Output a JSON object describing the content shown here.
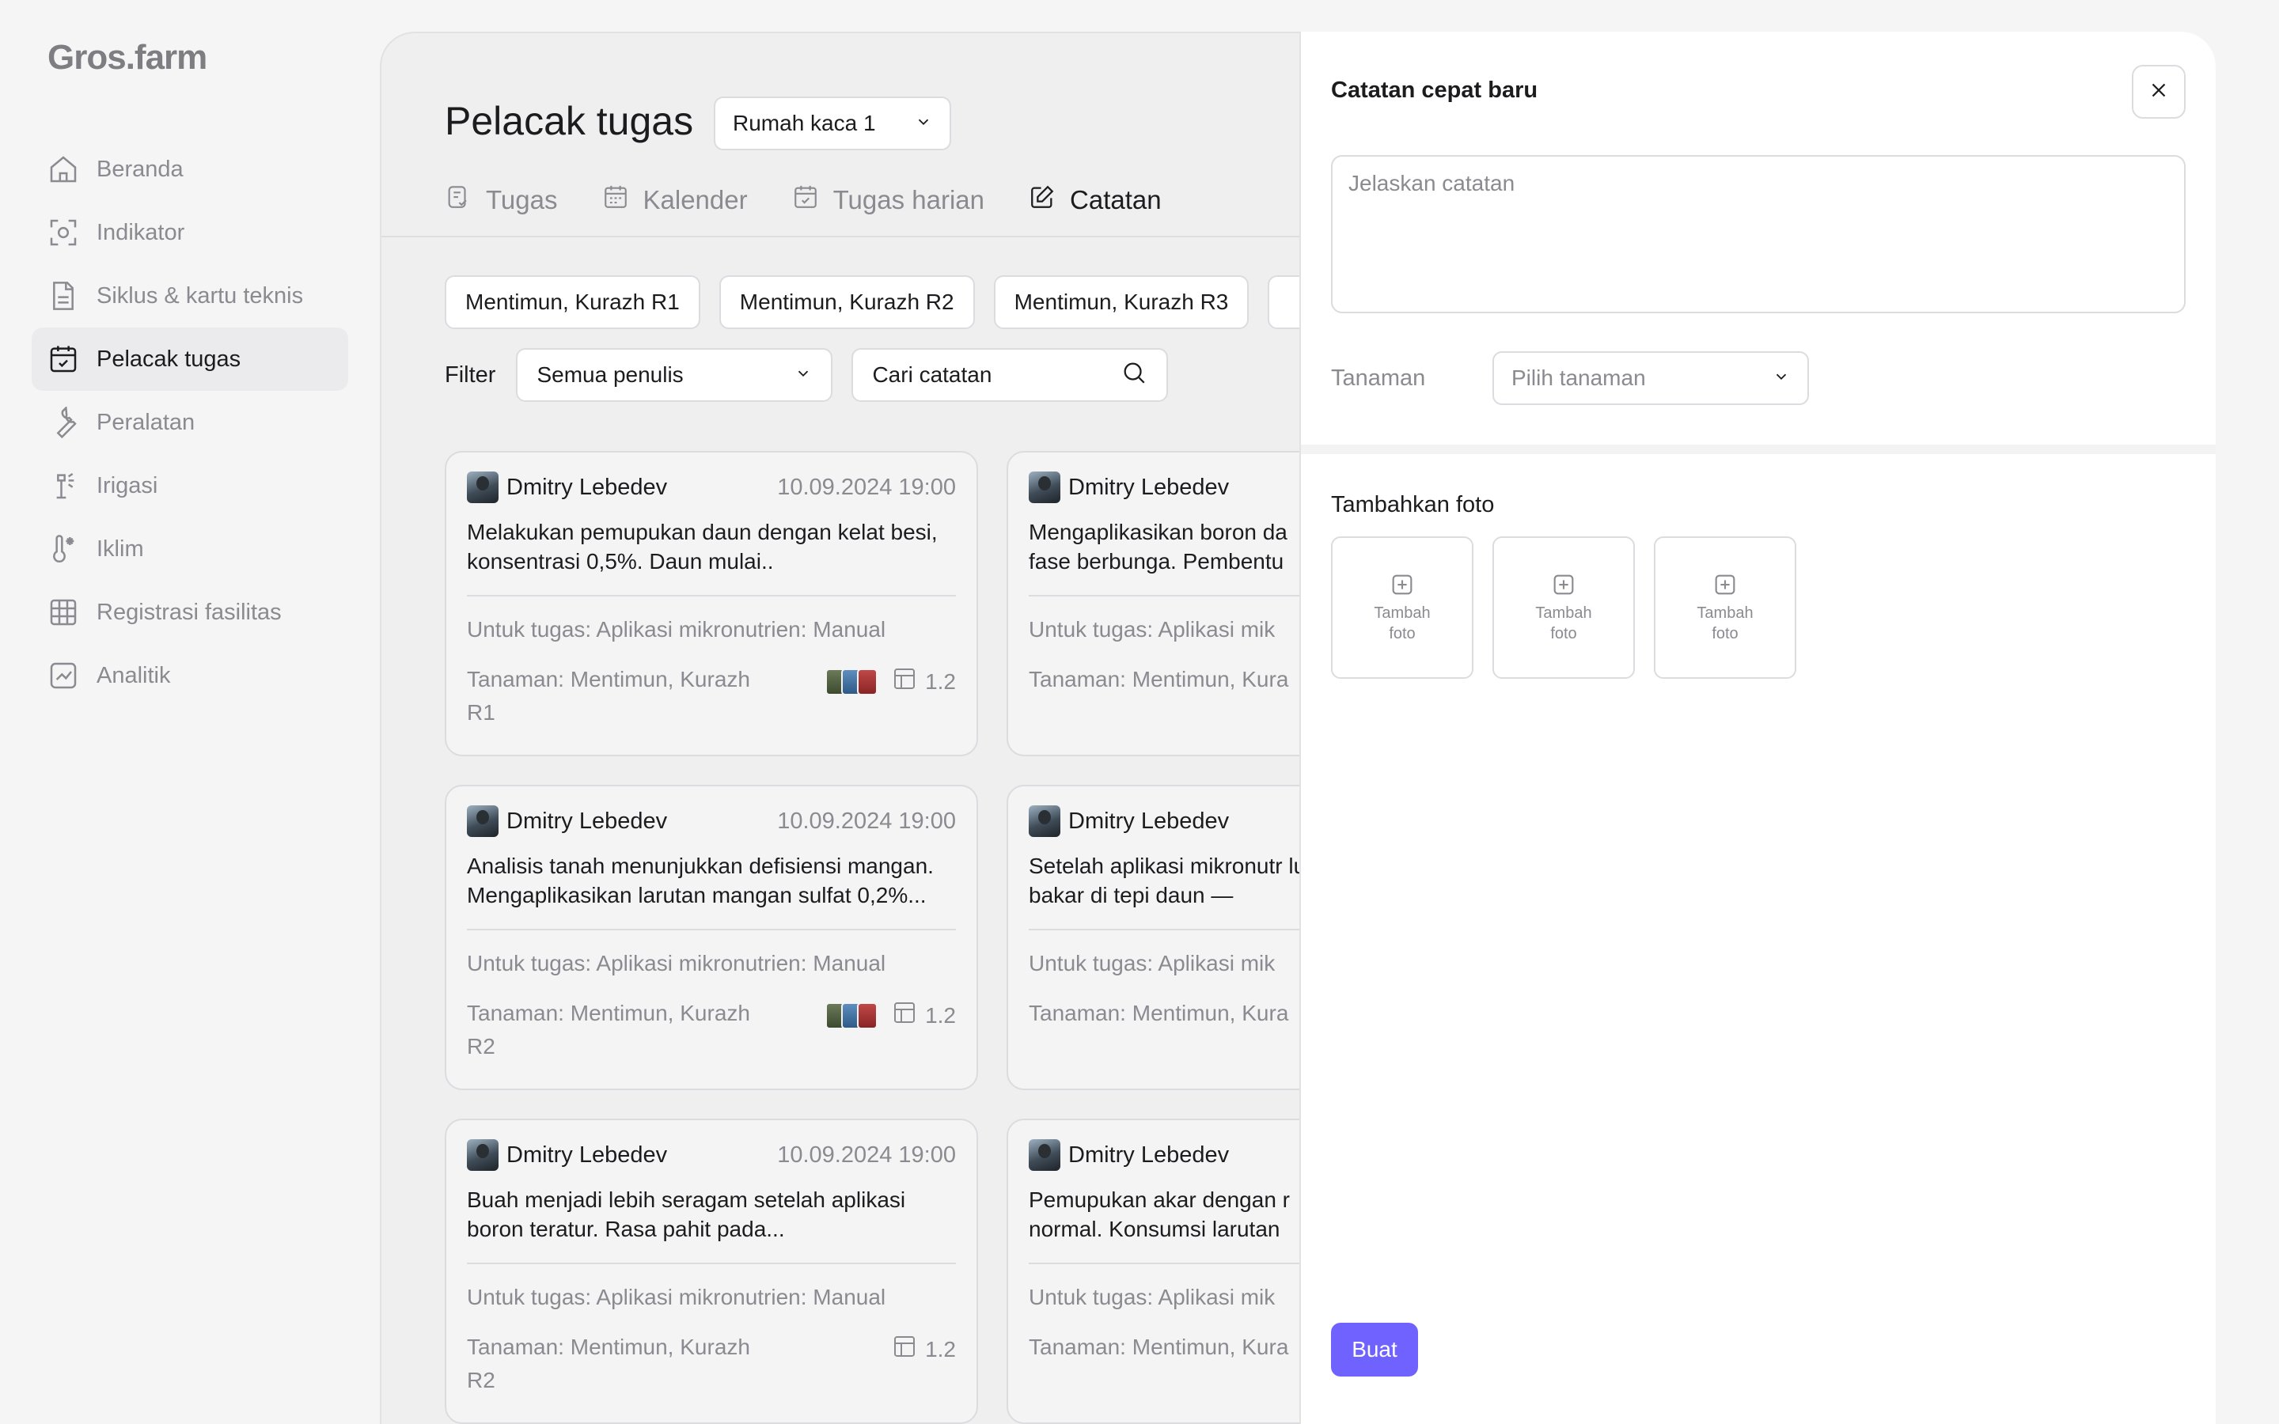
{
  "app": {
    "logo": "Gros.farm"
  },
  "sidebar": {
    "items": [
      {
        "label": "Beranda",
        "icon": "home-icon",
        "active": false
      },
      {
        "label": "Indikator",
        "icon": "sensor-icon",
        "active": false
      },
      {
        "label": "Siklus & kartu teknis",
        "icon": "document-icon",
        "active": false
      },
      {
        "label": "Pelacak tugas",
        "icon": "calendar-check-icon",
        "active": true
      },
      {
        "label": "Peralatan",
        "icon": "wrench-icon",
        "active": false
      },
      {
        "label": "Irigasi",
        "icon": "sprinkler-icon",
        "active": false
      },
      {
        "label": "Iklim",
        "icon": "thermometer-icon",
        "active": false
      },
      {
        "label": "Registrasi fasilitas",
        "icon": "grid-icon",
        "active": false
      },
      {
        "label": "Analitik",
        "icon": "chart-icon",
        "active": false
      }
    ]
  },
  "main": {
    "title": "Pelacak tugas",
    "greenhouse_select": "Rumah kaca 1",
    "tabs": [
      {
        "label": "Tugas",
        "icon": "tasks-icon",
        "active": false
      },
      {
        "label": "Kalender",
        "icon": "calendar-icon",
        "active": false
      },
      {
        "label": "Tugas harian",
        "icon": "calendar-check-icon",
        "active": false
      },
      {
        "label": "Catatan",
        "icon": "edit-note-icon",
        "active": true
      }
    ],
    "chips": [
      "Mentimun, Kurazh R1",
      "Mentimun, Kurazh R2",
      "Mentimun, Kurazh R3"
    ],
    "filter": {
      "label": "Filter",
      "author_select": "Semua penulis",
      "search_placeholder": "Cari catatan"
    },
    "cards": [
      {
        "author": "Dmitry Lebedev",
        "date": "10.09.2024 19:00",
        "text": "Melakukan pemupukan daun dengan kelat besi, konsentrasi 0,5%. Daun mulai..",
        "task": "Untuk tugas: Aplikasi mikronutrien: Manual",
        "plant": "Tanaman: Mentimun, Kurazh R1",
        "photos": true,
        "sector": "1.2"
      },
      {
        "author": "Dmitry Lebedev",
        "date": "",
        "text": "Mengaplikasikan boron da fase berbunga. Pembentu",
        "task": "Untuk tugas: Aplikasi mik",
        "plant": "Tanaman: Mentimun, Kura",
        "photos": false,
        "sector": ""
      },
      {
        "author": "Dmitry Lebedev",
        "date": "10.09.2024 19:00",
        "text": "Analisis tanah menunjukkan defisiensi mangan. Mengaplikasikan larutan mangan sulfat 0,2%...",
        "task": "Untuk tugas: Aplikasi mikronutrien: Manual",
        "plant": "Tanaman: Mentimun, Kurazh R2",
        "photos": true,
        "sector": "1.2"
      },
      {
        "author": "Dmitry Lebedev",
        "date": "",
        "text": "Setelah aplikasi mikronutr luka bakar di tepi daun —",
        "task": "Untuk tugas: Aplikasi mik",
        "plant": "Tanaman: Mentimun, Kura",
        "photos": false,
        "sector": ""
      },
      {
        "author": "Dmitry Lebedev",
        "date": "10.09.2024 19:00",
        "text": "Buah menjadi lebih seragam setelah aplikasi boron teratur. Rasa pahit pada...",
        "task": "Untuk tugas: Aplikasi mikronutrien: Manual",
        "plant": "Tanaman: Mentimun, Kurazh R2",
        "photos": false,
        "sector": "1.2"
      },
      {
        "author": "Dmitry Lebedev",
        "date": "",
        "text": "Pemupukan akar dengan r normal. Konsumsi larutan",
        "task": "Untuk tugas: Aplikasi mik",
        "plant": "Tanaman: Mentimun, Kura",
        "photos": false,
        "sector": ""
      }
    ]
  },
  "panel": {
    "title": "Catatan cepat baru",
    "note_placeholder": "Jelaskan catatan",
    "plant_label": "Tanaman",
    "plant_select_placeholder": "Pilih tanaman",
    "photo_title": "Tambahkan foto",
    "photo_slots": [
      "Tambah foto",
      "Tambah foto",
      "Tambah foto"
    ],
    "create_label": "Buat",
    "accent": "#6f62ff"
  }
}
